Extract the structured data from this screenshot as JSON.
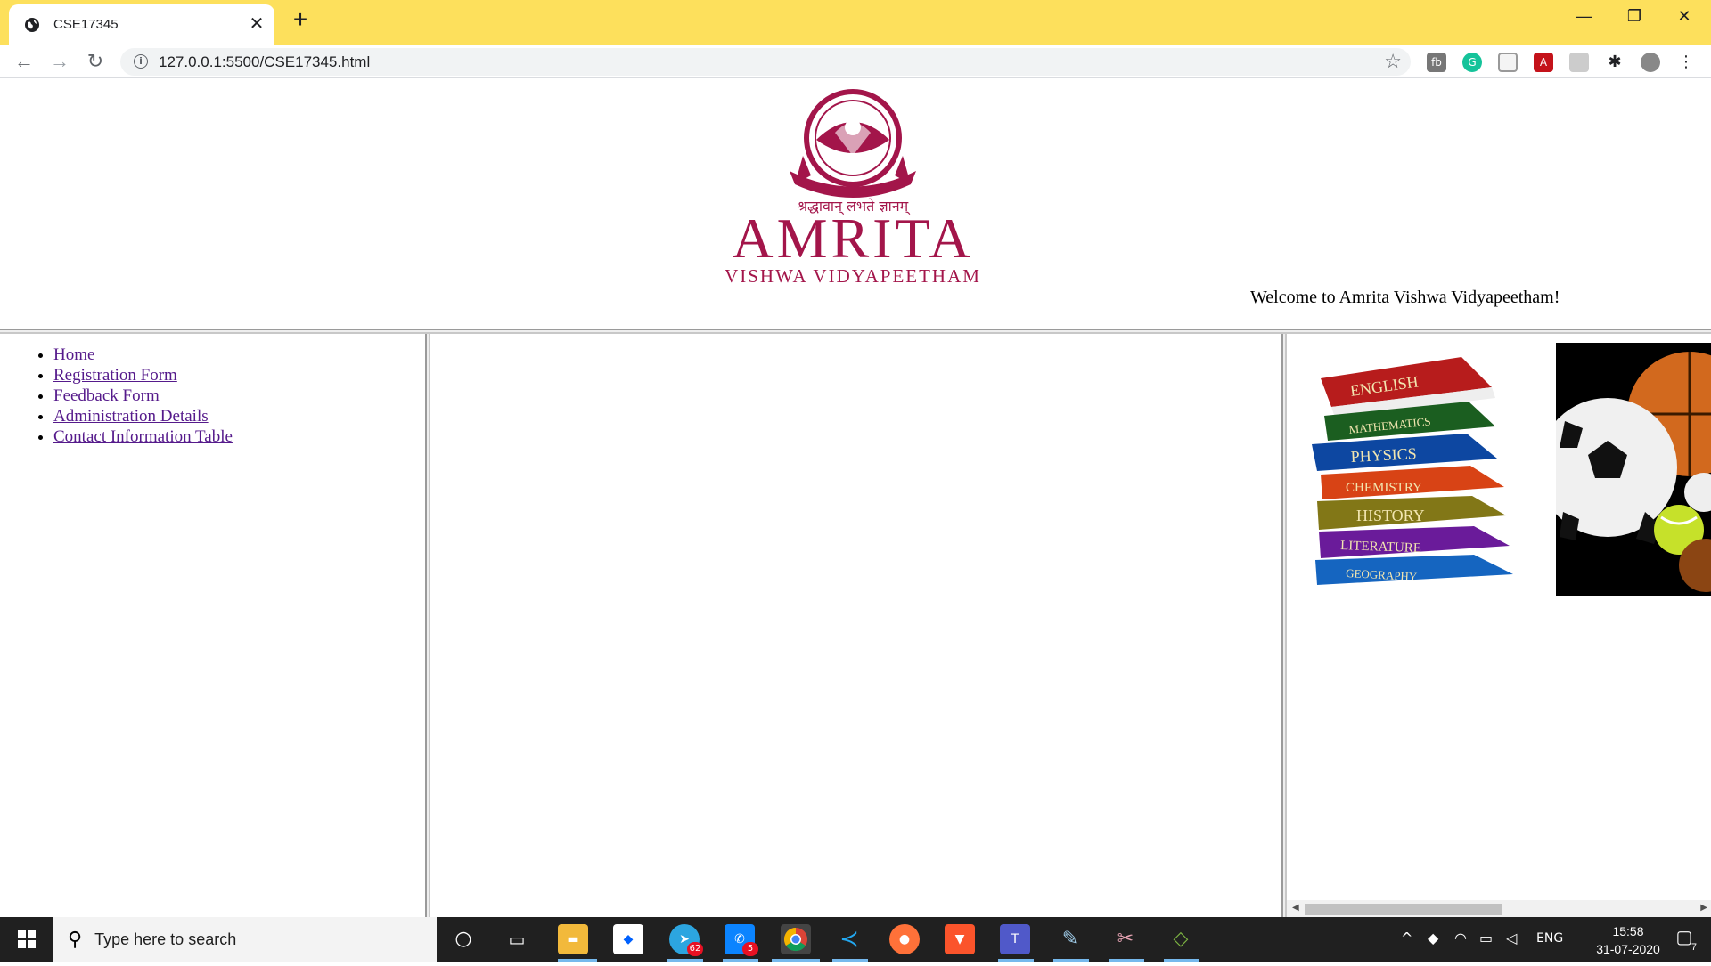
{
  "browser": {
    "tab_title": "CSE17345",
    "tab_close": "✕",
    "new_tab": "+",
    "url": "127.0.0.1:5500/CSE17345.html",
    "window_controls": [
      "—",
      "❐",
      "✕"
    ]
  },
  "header": {
    "logo_motto": "श्रद्धावान् लभते ज्ञानम्",
    "logo_title": "AMRITA",
    "logo_subtitle": "VISHWA VIDYAPEETHAM",
    "welcome": "Welcome to Amrita Vishwa Vidyapeetham!"
  },
  "nav": {
    "items": [
      {
        "label": "Home"
      },
      {
        "label": "Registration Form"
      },
      {
        "label": "Feedback Form"
      },
      {
        "label": "Administration Details"
      },
      {
        "label": "Contact Information Table"
      }
    ]
  },
  "books": [
    "ENGLISH",
    "MATHEMATICS",
    "PHYSICS",
    "CHEMISTRY",
    "HISTORY",
    "LITERATURE",
    "GEOGRAPHY"
  ],
  "taskbar": {
    "search_placeholder": "Type here to search",
    "telegram_badge": "62",
    "teams_badge": "5",
    "lang": "ENG",
    "time": "15:58",
    "date": "31-07-2020",
    "notifications": "7"
  },
  "colors": {
    "tabbar": "#fde05c",
    "amrita_maroon": "#a3154a",
    "link": "#551a8b"
  }
}
